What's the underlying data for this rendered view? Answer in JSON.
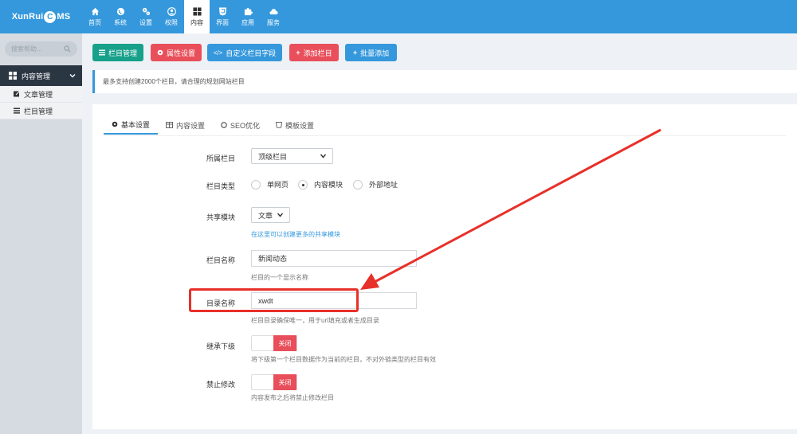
{
  "app": {
    "logo_text_left": "XunRui",
    "logo_c": "C",
    "logo_text_right": "MS"
  },
  "nav": [
    {
      "label": "首页",
      "icon": "home-icon"
    },
    {
      "label": "系统",
      "icon": "globe-icon"
    },
    {
      "label": "设置",
      "icon": "cogs-icon"
    },
    {
      "label": "权限",
      "icon": "user-icon"
    },
    {
      "label": "内容",
      "icon": "grid-icon",
      "active": true
    },
    {
      "label": "界面",
      "icon": "html5-icon"
    },
    {
      "label": "应用",
      "icon": "puzzle-icon"
    },
    {
      "label": "服务",
      "icon": "cloud-icon"
    }
  ],
  "sidebar": {
    "search_placeholder": "搜索帮助...",
    "main_item": "内容管理",
    "sub_items": [
      {
        "label": "文章管理",
        "icon": "edit-icon"
      },
      {
        "label": "栏目管理",
        "icon": "list-icon"
      }
    ]
  },
  "toolbar": {
    "b1": "栏目管理",
    "b2": "属性设置",
    "b3": "自定义栏目字段",
    "b4": "添加栏目",
    "b5": "批量添加"
  },
  "notice": "最多支持创建2000个栏目，请合理的规划网站栏目",
  "tabs": {
    "t1": "基本设置",
    "t2": "内容设置",
    "t3": "SEO优化",
    "t4": "模板设置"
  },
  "form": {
    "parent_label": "所属栏目",
    "parent_value": "顶级栏目",
    "type_label": "栏目类型",
    "type_opt1": "单网页",
    "type_opt2": "内容模块",
    "type_opt3": "外部地址",
    "type_selected": "内容模块",
    "module_label": "共享模块",
    "module_value": "文章",
    "module_link": "在这里可以创建更多的共享模块",
    "name_label": "栏目名称",
    "name_value": "新闻动态",
    "name_help": "栏目的一个显示名称",
    "dir_label": "目录名称",
    "dir_value": "xwdt",
    "dir_help": "栏目目录确保唯一，用于url填充或者生成目录",
    "inherit_label": "继承下级",
    "inherit_state": "关闭",
    "inherit_help": "将下级第一个栏目数据作为当前的栏目，不对外链类型的栏目有效",
    "lock_label": "禁止修改",
    "lock_state": "关闭",
    "lock_help": "内容发布之后将禁止修改栏目"
  },
  "colors": {
    "topbar": "#3598dc",
    "highlight": "#e8302a",
    "toggle_off": "#e84f5b"
  }
}
